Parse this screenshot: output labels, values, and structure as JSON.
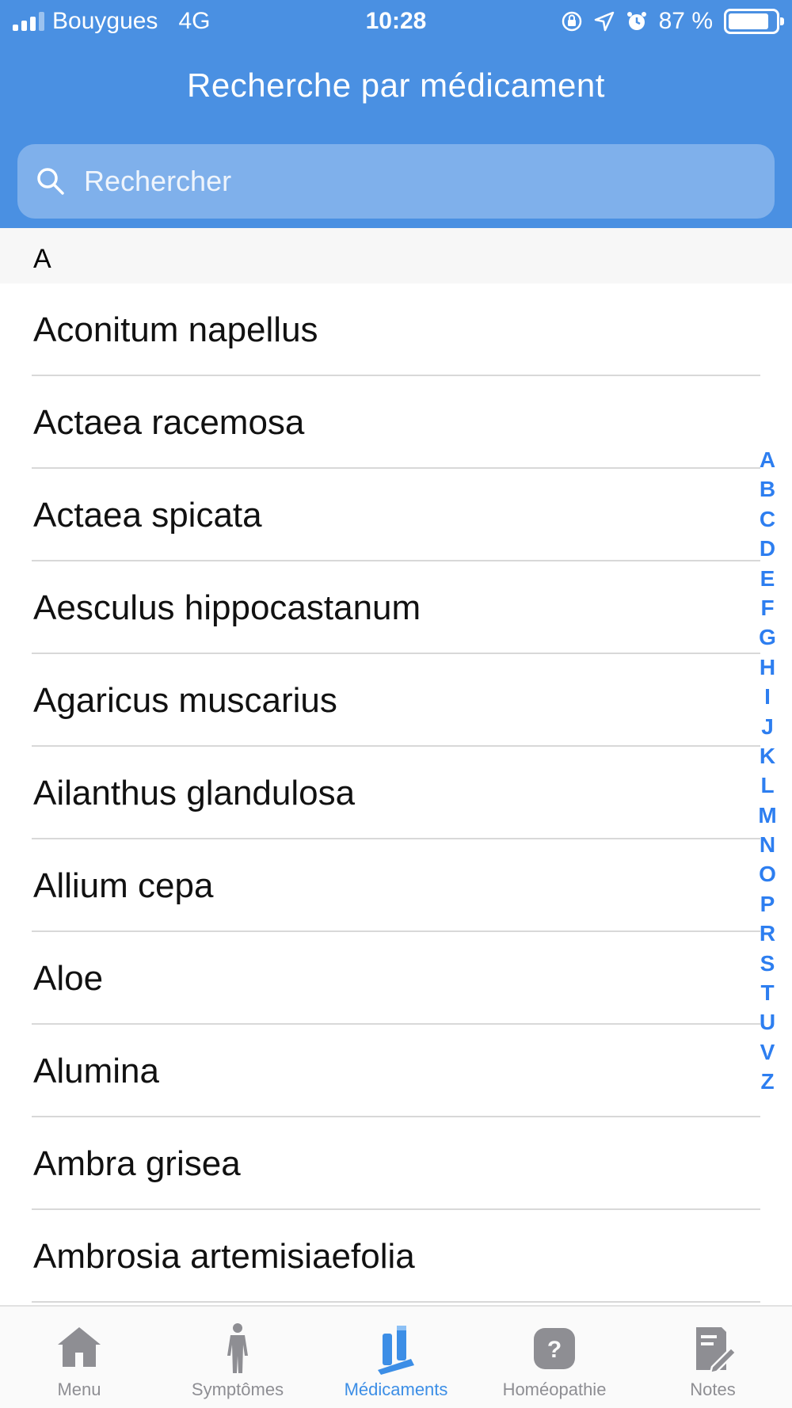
{
  "status_bar": {
    "carrier": "Bouygues",
    "network": "4G",
    "time": "10:28",
    "battery": "87 %",
    "battery_level": 0.87
  },
  "header": {
    "title": "Recherche par médicament"
  },
  "search": {
    "placeholder": "Rechercher"
  },
  "list": {
    "section": "A",
    "items": [
      "Aconitum napellus",
      "Actaea racemosa",
      "Actaea spicata",
      "Aesculus hippocastanum",
      "Agaricus muscarius",
      "Ailanthus glandulosa",
      "Allium cepa",
      "Aloe",
      "Alumina",
      "Ambra grisea",
      "Ambrosia artemisiaefolia"
    ]
  },
  "index_letters": [
    "A",
    "B",
    "C",
    "D",
    "E",
    "F",
    "G",
    "H",
    "I",
    "J",
    "K",
    "L",
    "M",
    "N",
    "O",
    "P",
    "R",
    "S",
    "T",
    "U",
    "V",
    "Z"
  ],
  "tabbar": {
    "tabs": [
      {
        "label": "Menu",
        "icon": "house-icon",
        "active": false
      },
      {
        "label": "Symptômes",
        "icon": "body-icon",
        "active": false
      },
      {
        "label": "Médicaments",
        "icon": "vials-icon",
        "active": true
      },
      {
        "label": "Homéopathie",
        "icon": "question-icon",
        "active": false
      },
      {
        "label": "Notes",
        "icon": "notes-icon",
        "active": false
      }
    ]
  },
  "colors": {
    "header_bg": "#4a90e2",
    "accent": "#2d7ef0",
    "tab_inactive": "#8e8e93"
  }
}
